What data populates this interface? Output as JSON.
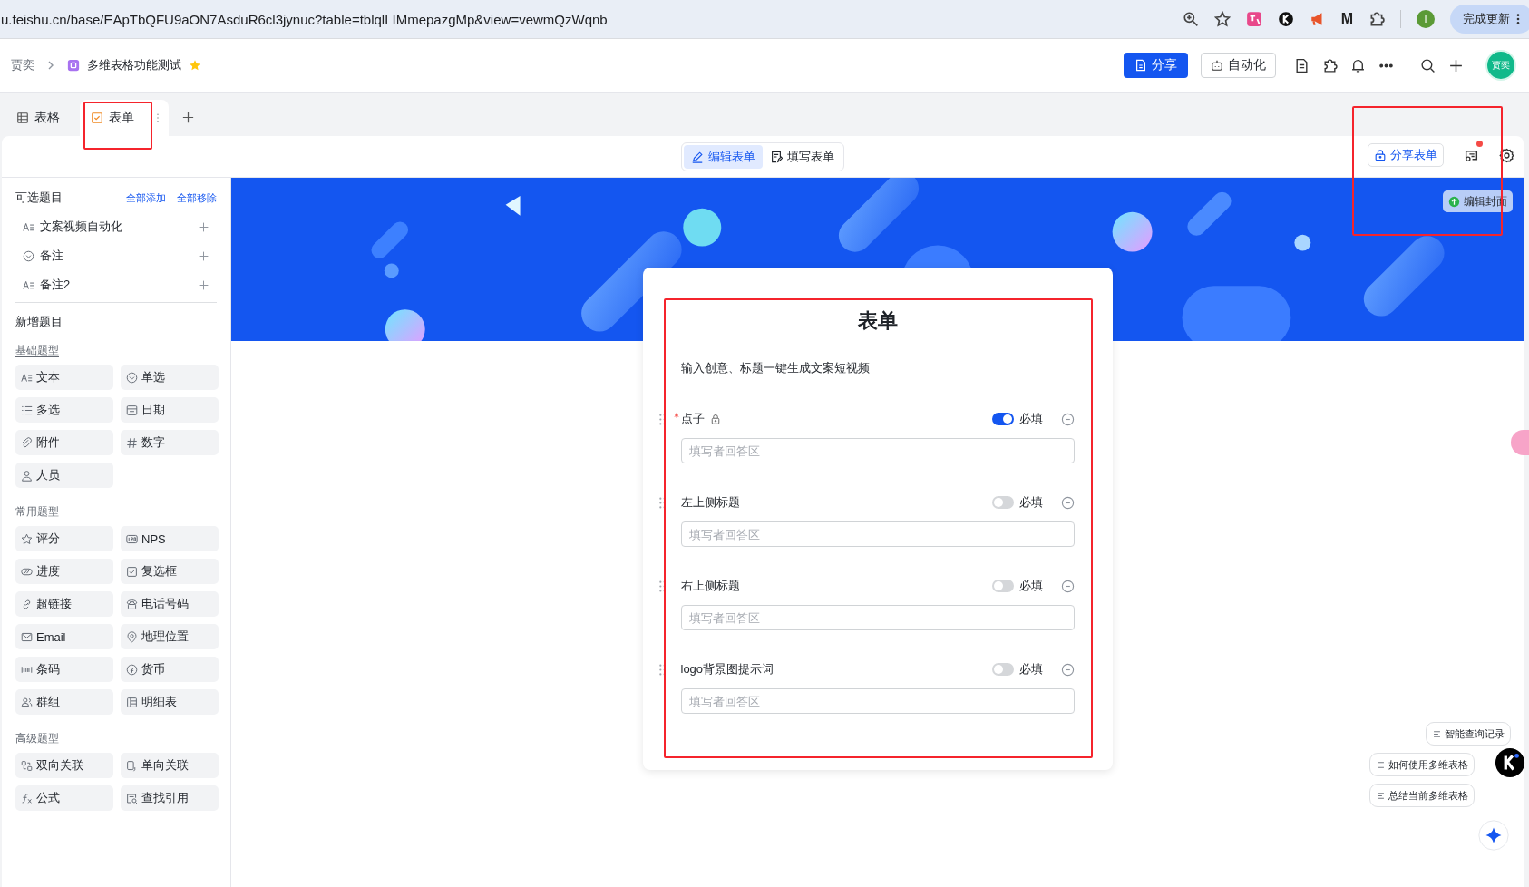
{
  "browser": {
    "url": "u.feishu.cn/base/EApTbQFU9aON7AsduR6cl3jynuc?table=tblqlLIMmepazgMp&view=vewmQzWqnb",
    "extension_letter": "M",
    "profile_initial": "I",
    "update_button": "完成更新"
  },
  "header": {
    "breadcrumb": [
      "贾奕",
      "多维表格功能测试"
    ],
    "share": "分享",
    "automation": "自动化",
    "avatar": "贾奕"
  },
  "tabs": [
    {
      "label": "表格",
      "kind": "grid",
      "selected": false
    },
    {
      "label": "表单",
      "kind": "form",
      "selected": true
    }
  ],
  "mode_switch": [
    {
      "label": "编辑表单",
      "kind": "edit",
      "selected": true
    },
    {
      "label": "填写表单",
      "kind": "fill",
      "selected": false
    }
  ],
  "share_form": "分享表单",
  "sidebar": {
    "title": "可选题目",
    "add_all": "全部添加",
    "remove_all": "全部移除",
    "optional": [
      {
        "label": "文案视频自动化",
        "kind": "text"
      },
      {
        "label": "备注",
        "kind": "select"
      },
      {
        "label": "备注2",
        "kind": "text"
      }
    ],
    "new_title": "新增题目",
    "groups": [
      {
        "title": "基础题型",
        "items": [
          {
            "label": "文本",
            "kind": "text"
          },
          {
            "label": "单选",
            "kind": "select"
          },
          {
            "label": "多选",
            "kind": "multi"
          },
          {
            "label": "日期",
            "kind": "date"
          },
          {
            "label": "附件",
            "kind": "attachment"
          },
          {
            "label": "数字",
            "kind": "number"
          },
          {
            "label": "人员",
            "kind": "person"
          }
        ]
      },
      {
        "title": "常用题型",
        "items": [
          {
            "label": "评分",
            "kind": "rating"
          },
          {
            "label": "NPS",
            "kind": "nps"
          },
          {
            "label": "进度",
            "kind": "progress"
          },
          {
            "label": "复选框",
            "kind": "checkbox"
          },
          {
            "label": "超链接",
            "kind": "link"
          },
          {
            "label": "电话号码",
            "kind": "phone"
          },
          {
            "label": "Email",
            "kind": "email"
          },
          {
            "label": "地理位置",
            "kind": "location"
          },
          {
            "label": "条码",
            "kind": "barcode"
          },
          {
            "label": "货币",
            "kind": "currency"
          },
          {
            "label": "群组",
            "kind": "group"
          },
          {
            "label": "明细表",
            "kind": "detail"
          }
        ]
      },
      {
        "title": "高级题型",
        "items": [
          {
            "label": "双向关联",
            "kind": "twoway"
          },
          {
            "label": "单向关联",
            "kind": "oneway"
          },
          {
            "label": "公式",
            "kind": "formula"
          },
          {
            "label": "查找引用",
            "kind": "lookup"
          }
        ]
      }
    ]
  },
  "cover": {
    "edit_button": "编辑封面"
  },
  "form": {
    "title": "表单",
    "description": "输入创意、标题一键生成文案短视频",
    "fields": [
      {
        "label": "点子",
        "locked": true,
        "required": true,
        "required_label": "必填",
        "placeholder": "填写者回答区"
      },
      {
        "label": "左上侧标题",
        "locked": false,
        "required": false,
        "required_label": "必填",
        "placeholder": "填写者回答区"
      },
      {
        "label": "右上侧标题",
        "locked": false,
        "required": false,
        "required_label": "必填",
        "placeholder": "填写者回答区"
      },
      {
        "label": "logo背景图提示词",
        "locked": false,
        "required": false,
        "required_label": "必填",
        "placeholder": "填写者回答区"
      }
    ]
  },
  "assistant": {
    "chips": [
      "智能查询记录",
      "如何使用多维表格",
      "总结当前多维表格"
    ]
  }
}
